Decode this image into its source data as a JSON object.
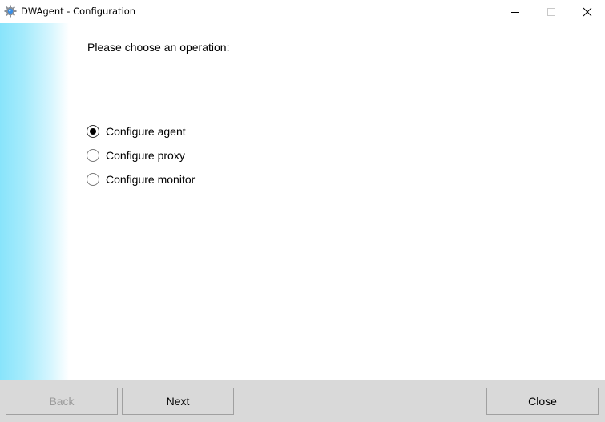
{
  "window": {
    "title": "DWAgent - Configuration",
    "icon": "gear-icon",
    "controls": {
      "minimize": "minimize-icon",
      "maximize": "maximize-icon",
      "close": "close-icon"
    }
  },
  "main": {
    "prompt": "Please choose an operation:",
    "options": [
      {
        "label": "Configure agent",
        "selected": true
      },
      {
        "label": "Configure proxy",
        "selected": false
      },
      {
        "label": "Configure monitor",
        "selected": false
      }
    ]
  },
  "footer": {
    "back_label": "Back",
    "back_enabled": false,
    "next_label": "Next",
    "close_label": "Close"
  },
  "colors": {
    "sidebar_gradient_start": "#88e4fb",
    "footer_bg": "#d9d9d9",
    "disabled_text": "#9a9a9a"
  }
}
